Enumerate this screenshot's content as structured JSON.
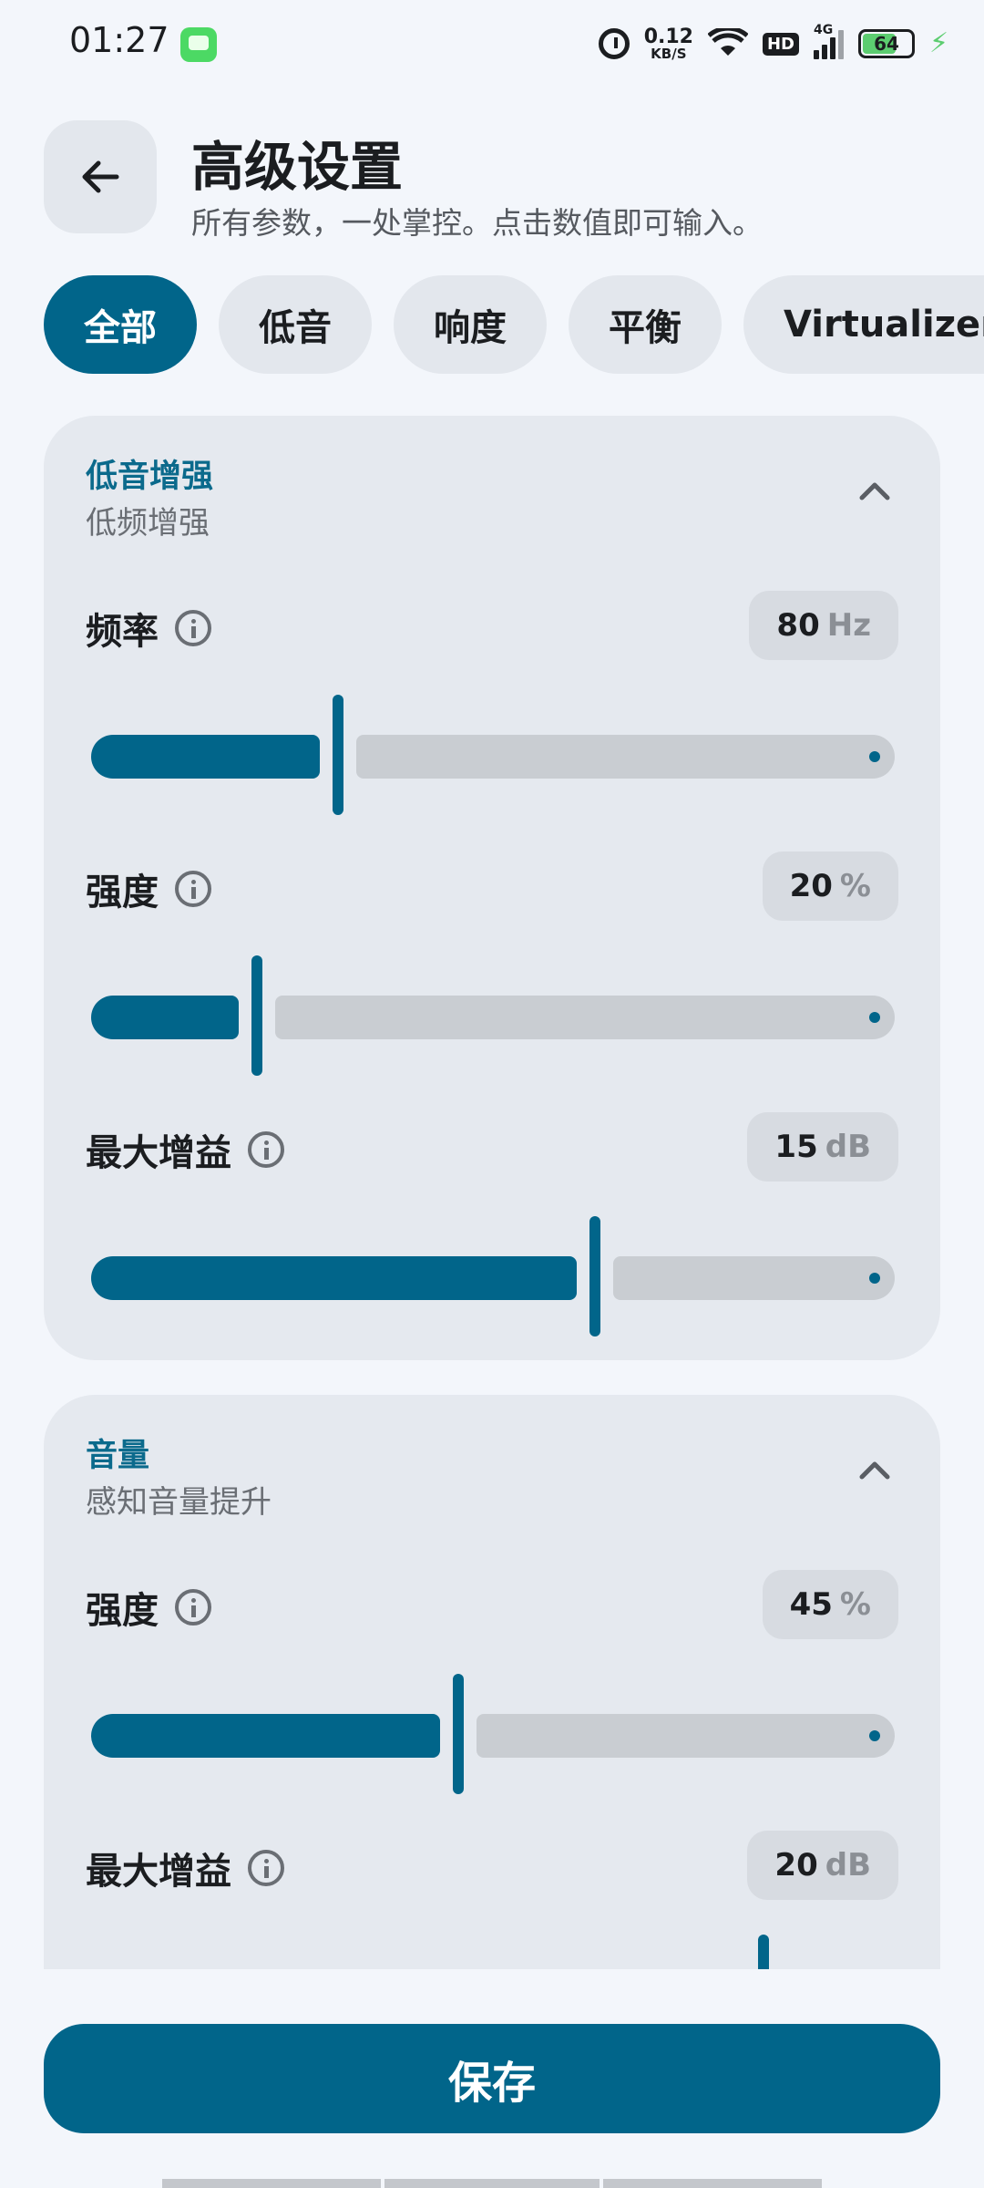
{
  "status_bar": {
    "time": "01:27",
    "net_speed_value": "0.12",
    "net_speed_unit": "KB/S",
    "hd": "HD",
    "network": "4G",
    "battery": "64",
    "icons": [
      "messages-app-icon",
      "alarm-icon",
      "wifi-icon",
      "signal-icon",
      "battery-icon",
      "charging-icon"
    ]
  },
  "header": {
    "title": "高级设置",
    "subtitle": "所有参数，一处掌控。点击数值即可输入。"
  },
  "tabs": [
    "全部",
    "低音",
    "响度",
    "平衡",
    "Virtualizer"
  ],
  "active_tab": "全部",
  "sections": [
    {
      "title": "低音增强",
      "subtitle": "低频增强",
      "params": [
        {
          "label": "频率",
          "value": "80",
          "unit": "Hz",
          "fill": 0.3
        },
        {
          "label": "强度",
          "value": "20",
          "unit": "%",
          "fill": 0.2
        },
        {
          "label": "最大增益",
          "value": "15",
          "unit": "dB",
          "fill": 0.62
        }
      ]
    },
    {
      "title": "音量",
      "subtitle": "感知音量提升",
      "params": [
        {
          "label": "强度",
          "value": "45",
          "unit": "%",
          "fill": 0.45
        },
        {
          "label": "最大增益",
          "value": "20",
          "unit": "dB",
          "fill": 0.83
        }
      ]
    }
  ],
  "save_label": "保存",
  "colors": {
    "accent": "#01658a",
    "card": "#e5e9ef",
    "background": "#f3f6fb"
  }
}
